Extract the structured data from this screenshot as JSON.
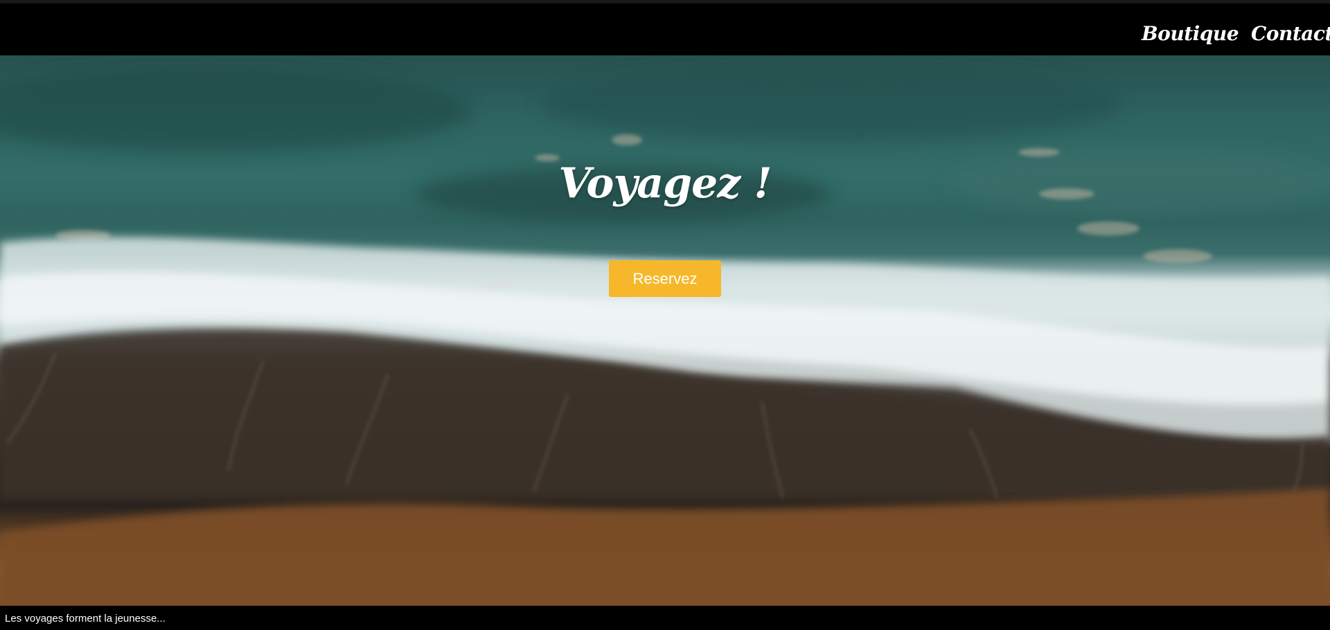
{
  "nav": {
    "links": [
      "Boutique",
      "Contact"
    ]
  },
  "hero": {
    "title": "Voyagez !",
    "button_label": "Reservez",
    "button_color": "#f6b82a",
    "background": "aerial-ocean-waves-beach-image"
  },
  "footer": {
    "text": "Les voyages forment la jeunesse..."
  }
}
